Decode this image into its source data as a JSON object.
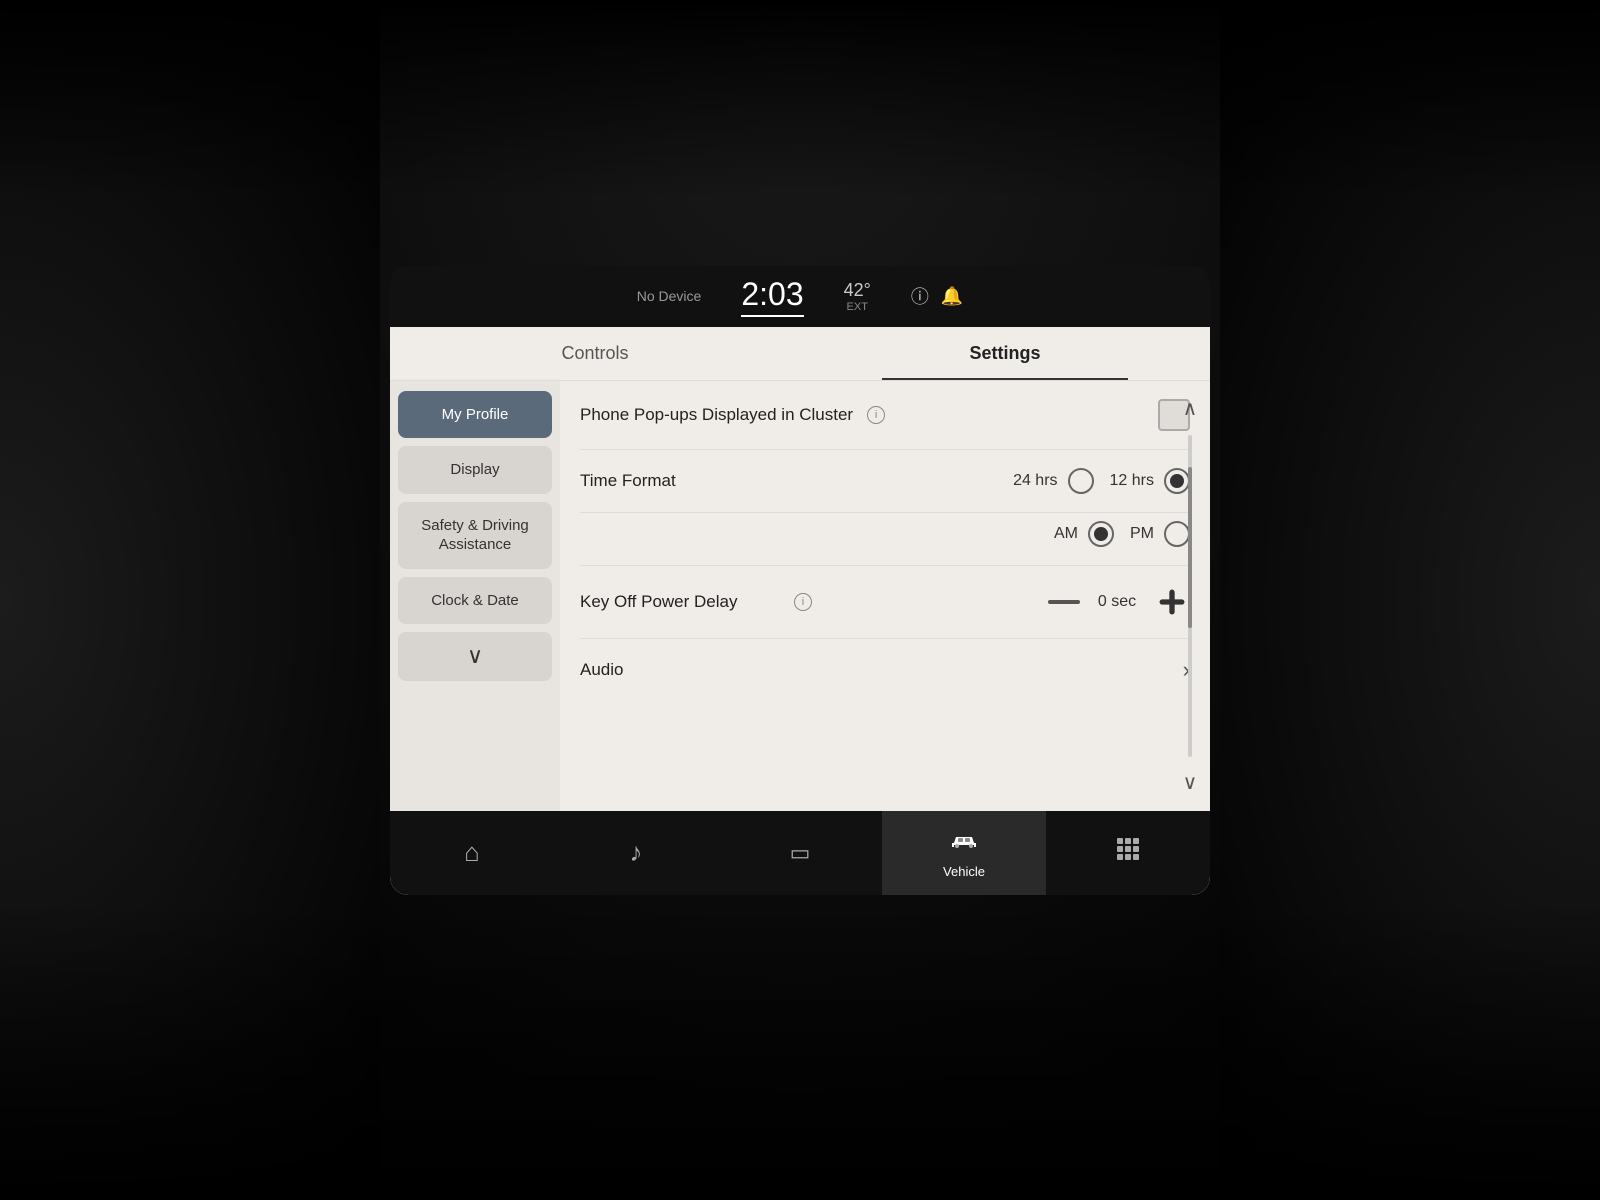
{
  "status_bar": {
    "no_device": "No Device",
    "time": "2:03",
    "temperature": "42°",
    "temp_unit": "EXT",
    "info_icon": "ⓘ",
    "bell_icon": "🔔"
  },
  "tabs": {
    "controls": "Controls",
    "settings": "Settings",
    "active": "settings"
  },
  "sidebar": {
    "items": [
      {
        "id": "my-profile",
        "label": "My Profile",
        "active": true
      },
      {
        "id": "display",
        "label": "Display",
        "active": false
      },
      {
        "id": "safety-driving",
        "label": "Safety & Driving Assistance",
        "active": false
      },
      {
        "id": "clock-date",
        "label": "Clock & Date",
        "active": false
      }
    ],
    "chevron_down": "∨"
  },
  "settings": {
    "phone_popups": {
      "label": "Phone Pop-ups Displayed in Cluster",
      "info": "i",
      "checked": false
    },
    "time_format": {
      "label": "Time Format",
      "option_24": "24 hrs",
      "option_12": "12 hrs",
      "selected": "12"
    },
    "am_pm": {
      "option_am": "AM",
      "option_pm": "PM",
      "selected": "AM"
    },
    "key_off_power_delay": {
      "label": "Key Off Power Delay",
      "info": "i",
      "value": "0 sec"
    },
    "audio": {
      "label": "Audio"
    }
  },
  "bottom_nav": {
    "items": [
      {
        "id": "home",
        "icon": "⌂",
        "label": ""
      },
      {
        "id": "music",
        "icon": "♪",
        "label": ""
      },
      {
        "id": "phone",
        "icon": "📱",
        "label": ""
      },
      {
        "id": "vehicle",
        "icon": "🚗",
        "label": "Vehicle",
        "active": true
      },
      {
        "id": "apps",
        "icon": "⊞",
        "label": ""
      }
    ]
  }
}
